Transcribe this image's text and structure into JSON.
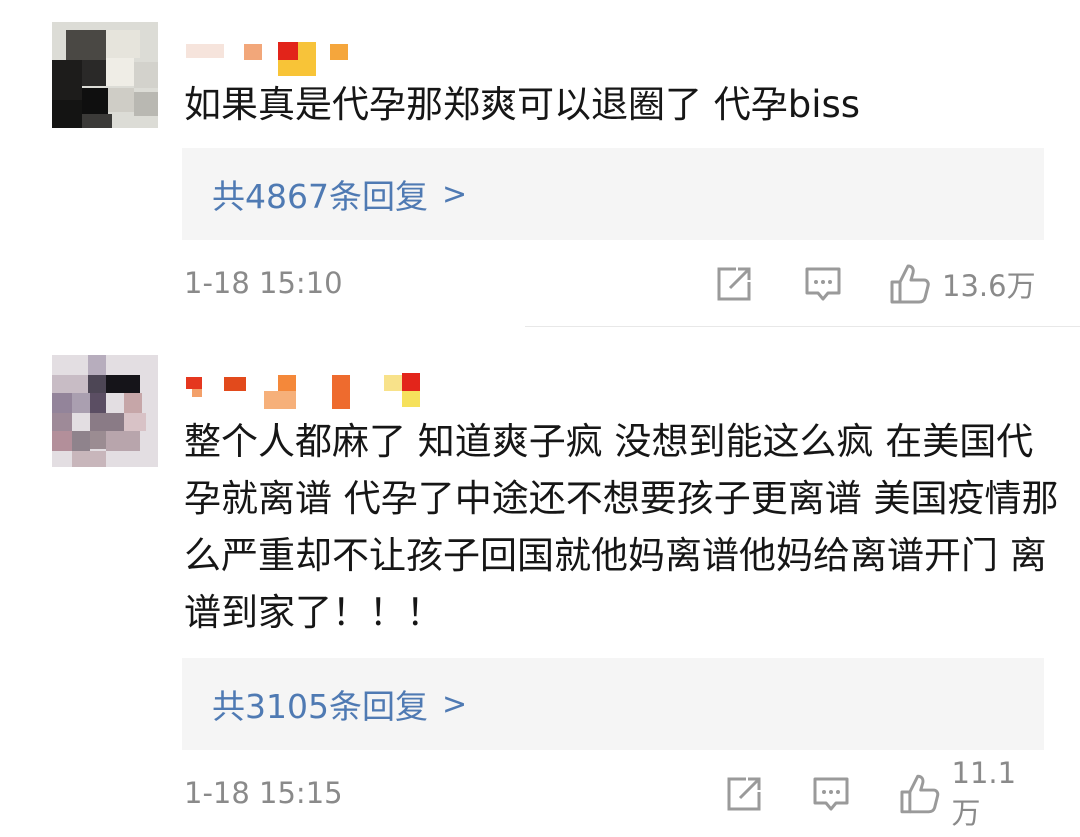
{
  "comments": [
    {
      "text": "如果真是代孕那郑爽可以退圈了 代孕biss",
      "replies_label": "共4867条回复",
      "replies_chevron": ">",
      "time": "1-18 15:10",
      "likes": "13.6万"
    },
    {
      "text": "整个人都麻了 知道爽子疯 没想到能这么疯 在美国代孕就离谱 代孕了中途还不想要孩子更离谱 美国疫情那么严重却不让孩子回国就他妈离谱他妈给离谱开门 离谱到家了！！！",
      "replies_label": "共3105条回复",
      "replies_chevron": ">",
      "time": "1-18 15:15",
      "likes": "11.1万"
    }
  ],
  "colors": {
    "reply_link": "#4f7ab3",
    "meta_gray": "#8a8a8a",
    "reply_bg": "#f5f5f5",
    "icon_gray": "#9a9a9a"
  },
  "icons": [
    "share-icon",
    "comment-icon",
    "like-icon"
  ]
}
